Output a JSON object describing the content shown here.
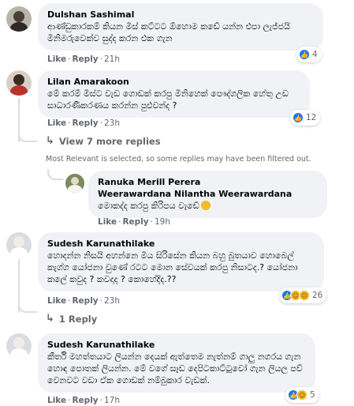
{
  "comments": [
    {
      "author": "Dulshan Sashimal",
      "text": "ආණ්ඩුකාරකම් කියන මිස් කට්ටට ඕහොම කඩේ යන්න එපා ලැජ්ජයි මිනිමරුවෙක්ව සුද්ද කරන එක ගැන",
      "like_label": "Like",
      "reply_label": "Reply",
      "time": "21h",
      "reaction_count": "4"
    },
    {
      "author": "Lilan Amarakoon",
      "text": "මේ කරම් මිස්ට වැඩ ගොඩක් කරපු මිනිහෙක් පෞද්ගලික හේතු උඩ සාධාරණීකරණය කරන්න පුළුවන්ද ?",
      "like_label": "Like",
      "reply_label": "Reply",
      "time": "23h",
      "reaction_count": "12"
    },
    {
      "author": "Sudesh Karunathilake",
      "text": "හොදන්න නිසයි අහන්නෙ මිය සිරිසේන කියන බහු බුතයාව හොබෙල් කැග්ග යෝජනා වුණේ රටට මොන සේවයක් කරපු නිසාටද.? යෝජනා කලේ කවුද ? කවදාද ? කොහේදීද.??",
      "like_label": "Like",
      "reply_label": "Reply",
      "time": "23h",
      "reaction_count": "26"
    },
    {
      "author": "Sudesh Karunathilake",
      "text": "කීර්ති මහත්තයාට ලියන්න දෙයක් ඇත්තෙම නැත්නම් ගාලු නගරය ගැන හොඳ පොතක් ලියන්න. මේ වගේ සෑඩ දෙපිටකාට්ටුවෝ ගැන ලියල පව් වෙනවට වඩා ඒක ගොඩක් නම්බුකාර වැඩක්.",
      "like_label": "Like",
      "reply_label": "Reply",
      "time": "17h",
      "reaction_count": "5"
    }
  ],
  "view_more_replies": "View 7 more replies",
  "filter_note": "Most Relevant is selected, so some replies may have been filtered out.",
  "reply": {
    "author": "Ranuka Merill Perera",
    "mention": "Weerawardana Nilantha Weerawardana",
    "text": "මොකද්ද කරපු කිරිපය වැඩේ",
    "like_label": "Like",
    "reply_label": "Reply",
    "time": "19h"
  },
  "one_reply": "1 Reply",
  "colors": {
    "bubble": "#f0f2f5",
    "meta_text": "#65676b",
    "like_blue": "#1877f2",
    "emoji_yellow": "#f7b928"
  },
  "icons": {
    "like": "like-icon",
    "haha": "haha-icon",
    "sad": "sad-icon",
    "reply_arrow": "reply-arrow-icon"
  }
}
